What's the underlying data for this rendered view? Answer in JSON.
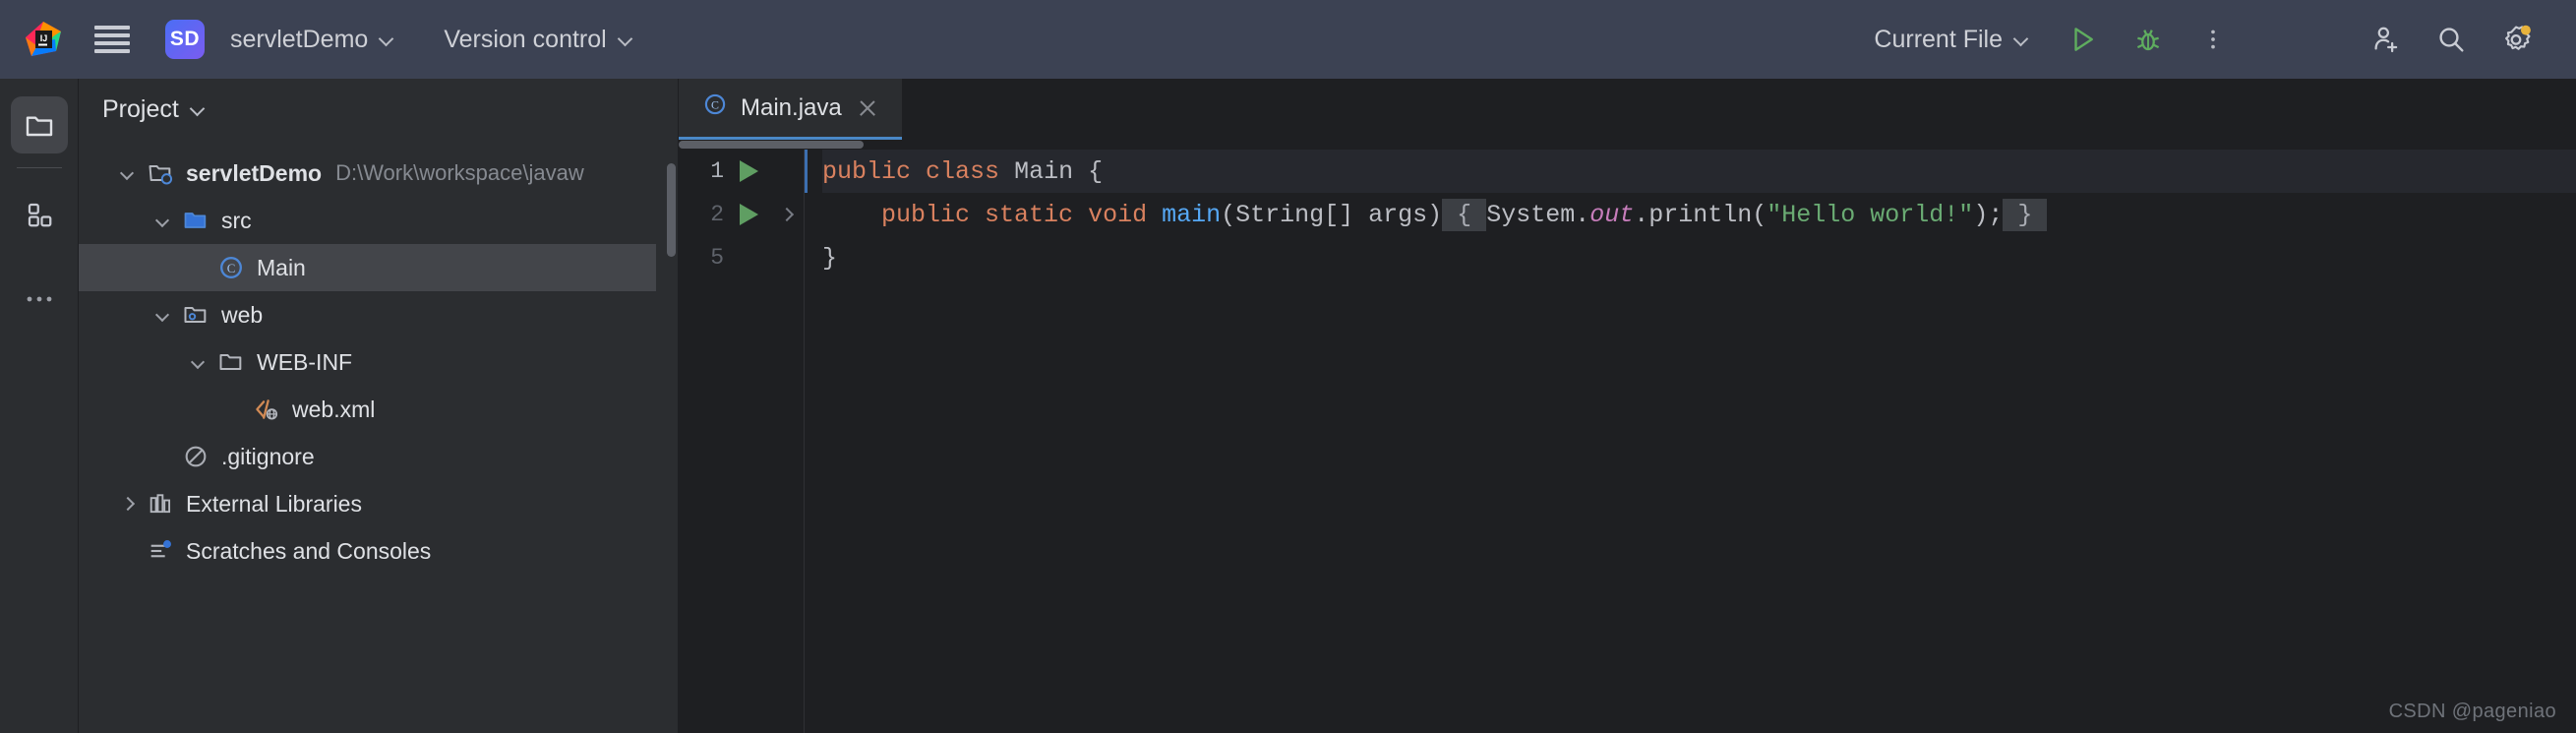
{
  "topbar": {
    "logo_icon": "intellij-idea-logo",
    "menu_icon": "hamburger-menu-icon",
    "project_badge": "SD",
    "project_name": "servletDemo",
    "version_control": "Version control",
    "run_config": "Current File",
    "run_icon": "run-play-icon",
    "debug_icon": "debug-bug-icon",
    "more_icon": "more-vertical-icon",
    "add_user_icon": "add-user-icon",
    "search_icon": "search-icon",
    "settings_icon": "settings-gear-icon",
    "settings_badge_color": "#e8b33c",
    "accent_blue": "#4b6ef5",
    "bar_color": "#3c4253"
  },
  "toolstrip": {
    "items": [
      {
        "name": "project-folder-icon",
        "active": true
      },
      {
        "name": "structure-blocks-icon",
        "active": false
      },
      {
        "name": "more-horizontal-icon",
        "active": false
      }
    ]
  },
  "project_panel": {
    "title": "Project",
    "title_chevron": "chevron-down-icon",
    "tree": [
      {
        "label": "servletDemo",
        "path": "D:\\Work\\workspace\\javaw",
        "icon": "module-folder-icon",
        "twisty": "down",
        "indent": 0,
        "bold": true,
        "selected": false
      },
      {
        "label": "src",
        "path": "",
        "icon": "source-folder-icon",
        "twisty": "down",
        "indent": 1,
        "bold": false,
        "selected": false
      },
      {
        "label": "Main",
        "path": "",
        "icon": "java-class-icon",
        "twisty": "none",
        "indent": 2,
        "bold": false,
        "selected": true
      },
      {
        "label": "web",
        "path": "",
        "icon": "web-folder-icon",
        "twisty": "down",
        "indent": 1,
        "bold": false,
        "selected": false
      },
      {
        "label": "WEB-INF",
        "path": "",
        "icon": "folder-icon",
        "twisty": "down",
        "indent": 2,
        "bold": false,
        "selected": false
      },
      {
        "label": "web.xml",
        "path": "",
        "icon": "xml-file-icon",
        "twisty": "none",
        "indent": 3,
        "bold": false,
        "selected": false
      },
      {
        "label": ".gitignore",
        "path": "",
        "icon": "gitignore-icon",
        "twisty": "none",
        "indent": 1,
        "bold": false,
        "selected": false
      },
      {
        "label": "External Libraries",
        "path": "",
        "icon": "libraries-icon",
        "twisty": "right",
        "indent": 0,
        "bold": false,
        "selected": false
      },
      {
        "label": "Scratches and Consoles",
        "path": "",
        "icon": "scratches-icon",
        "twisty": "none",
        "indent": 0,
        "bold": false,
        "selected": false
      }
    ]
  },
  "editor": {
    "tab": {
      "label": "Main.java",
      "icon": "java-class-icon",
      "close_icon": "close-icon"
    },
    "lines": [
      {
        "number": "1",
        "gutter_run": true,
        "gutter_fold": false,
        "current": true
      },
      {
        "number": "2",
        "gutter_run": true,
        "gutter_fold": true,
        "current": false
      },
      {
        "number": "5",
        "gutter_run": false,
        "gutter_fold": false,
        "current": false
      }
    ],
    "code": {
      "l1_kw_public": "public",
      "l1_kw_class": "class",
      "l1_name": "Main",
      "l1_brace": "{",
      "l2_indent": "    ",
      "l2_kw_public": "public",
      "l2_kw_static": "static",
      "l2_kw_void": "void",
      "l2_fn": "main",
      "l2_params": "(String[] args)",
      "l2_fold_open": " { ",
      "l2_system": "System.",
      "l2_out": "out",
      "l2_println": ".println(",
      "l2_string": "\"Hello world!\"",
      "l2_end": ");",
      "l2_fold_close": " } ",
      "l5_brace": "}"
    }
  },
  "watermark": "CSDN @pageniao"
}
